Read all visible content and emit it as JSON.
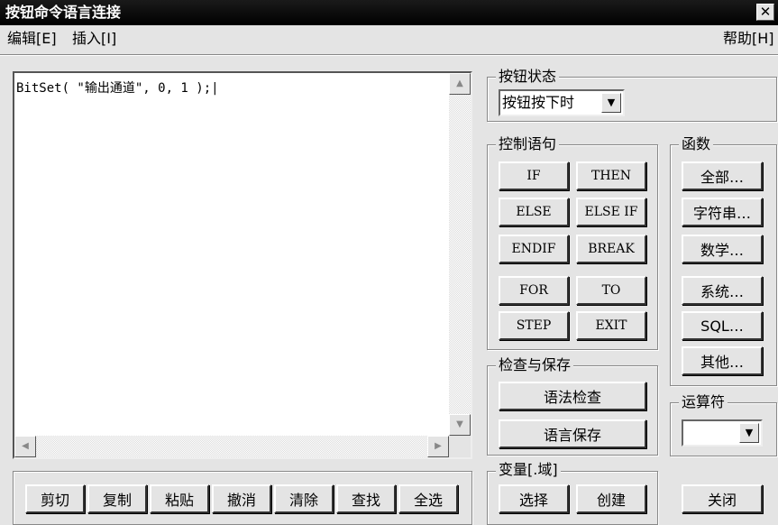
{
  "window": {
    "title": "按钮命令语言连接",
    "close_glyph": "✕"
  },
  "menu": {
    "edit": "编辑[E]",
    "insert": "插入[I]",
    "help": "帮助[H]"
  },
  "editor": {
    "content": "BitSet( \"输出通道\", 0, 1 );|",
    "scroll_up": "▲",
    "scroll_down": "▼",
    "scroll_left": "◀",
    "scroll_right": "▶"
  },
  "button_state": {
    "label": "按钮状态",
    "value": "按钮按下时",
    "arrow": "▼"
  },
  "control": {
    "label": "控制语句",
    "buttons": [
      "IF",
      "THEN",
      "ELSE",
      "ELSE IF",
      "ENDIF",
      "BREAK",
      "FOR",
      "TO",
      "STEP",
      "EXIT"
    ]
  },
  "functions": {
    "label": "函数",
    "buttons": [
      "全部…",
      "字符串…",
      "数学…",
      "系统…",
      "SQL…",
      "其他…"
    ]
  },
  "check": {
    "label": "检查与保存",
    "syntax": "语法检查",
    "save": "语言保存"
  },
  "operator": {
    "label": "运算符",
    "arrow": "▼"
  },
  "variable": {
    "label": "变量[.域]",
    "select": "选择",
    "create": "创建"
  },
  "edit_buttons": [
    "剪切",
    "复制",
    "粘贴",
    "撤消",
    "清除",
    "查找",
    "全选"
  ],
  "close": "关闭"
}
